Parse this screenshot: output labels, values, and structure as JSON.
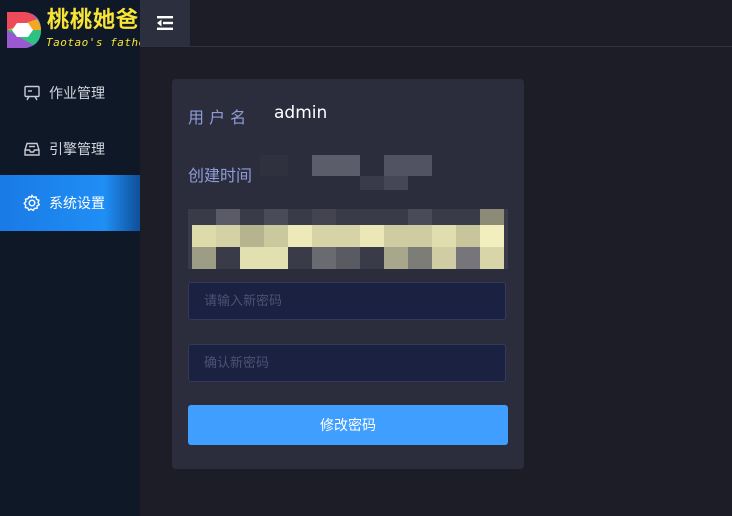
{
  "app": {
    "title": "桃桃她爸",
    "subtitle": "Taotao's father"
  },
  "sidebar": {
    "items": [
      {
        "label": "作业管理",
        "icon": "presentation-board-icon",
        "active": false
      },
      {
        "label": "引擎管理",
        "icon": "inbox-tray-icon",
        "active": false
      },
      {
        "label": "系统设置",
        "icon": "gear-icon",
        "active": true
      }
    ]
  },
  "header": {
    "toggle_icon": "menu-fold-icon"
  },
  "profile": {
    "username_label": "用 户 名",
    "username_value": "admin",
    "created_label": "创建时间"
  },
  "form": {
    "new_password_placeholder": "请输入新密码",
    "confirm_password_placeholder": "确认新密码",
    "submit_label": "修改密码"
  },
  "colors": {
    "sidebar_bg": "#0f1827",
    "active_accent": "#1f8ef5",
    "button": "#409eff",
    "logo": "#f7e436"
  }
}
